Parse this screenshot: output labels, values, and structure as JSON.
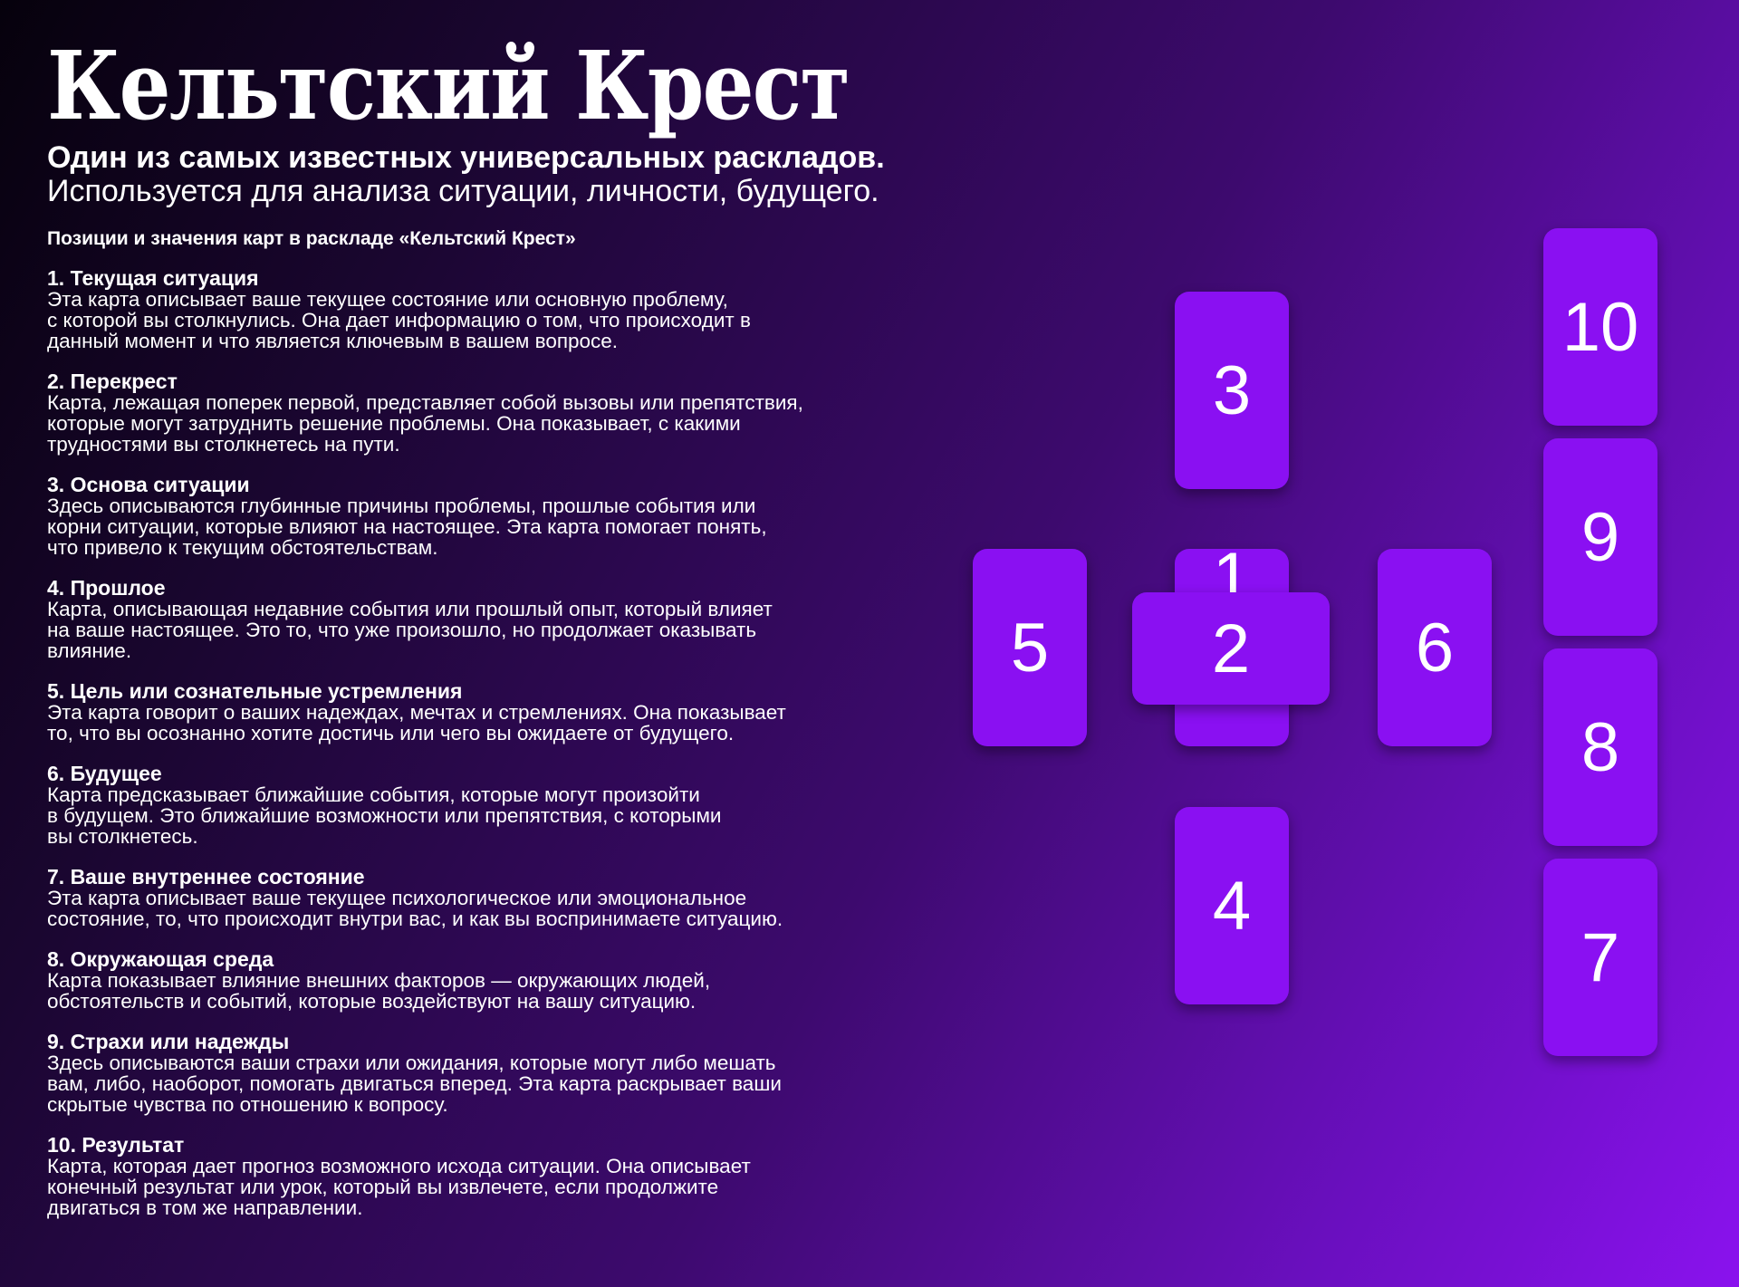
{
  "title": "Кельтский Крест",
  "subtitle_bold": "Один из самых известных универсальных раскладов.",
  "subtitle_regular": "Используется для анализа ситуации, личности, будущего.",
  "list_heading": "Позиции и значения карт в раскладе «Кельтский Крест»",
  "positions": [
    {
      "title": "1.  Текущая ситуация",
      "description": "Эта карта описывает ваше текущее состояние или основную проблему,\nс которой вы столкнулись. Она дает информацию о том, что происходит в\nданный момент и что является ключевым в вашем вопросе."
    },
    {
      "title": "2.  Перекрест",
      "description": "Карта, лежащая поперек первой, представляет собой вызовы или препятствия,\nкоторые могут затруднить решение проблемы. Она показывает, с какими\nтрудностями вы столкнетесь на пути."
    },
    {
      "title": "3.  Основа ситуации",
      "description": "Здесь описываются глубинные причины проблемы, прошлые события или\nкорни ситуации, которые влияют на настоящее. Эта карта помогает понять,\nчто привело к текущим обстоятельствам."
    },
    {
      "title": "4.  Прошлое",
      "description": "Карта, описывающая недавние события или прошлый опыт, который влияет\nна ваше настоящее. Это то, что уже произошло, но продолжает оказывать\nвлияние."
    },
    {
      "title": "5.  Цель или сознательные устремления",
      "description": "Эта карта говорит о ваших надеждах, мечтах и стремлениях. Она показывает\nто, что вы осознанно хотите достичь или чего вы ожидаете от будущего."
    },
    {
      "title": "6.  Будущее",
      "description": "Карта предсказывает ближайшие события, которые могут произойти\nв будущем. Это ближайшие возможности или препятствия, с которыми\nвы столкнетесь."
    },
    {
      "title": "7.  Ваше внутреннее состояние",
      "description": "Эта карта описывает ваше текущее психологическое или эмоциональное\nсостояние, то, что происходит внутри вас, и как вы воспринимаете ситуацию."
    },
    {
      "title": "8.  Окружающая среда",
      "description": "Карта показывает влияние внешних факторов — окружающих людей,\nобстоятельств и событий, которые воздействуют на вашу ситуацию."
    },
    {
      "title": "9.  Страхи или надежды",
      "description": "Здесь описываются ваши страхи или ожидания, которые могут либо мешать\nвам, либо, наоборот, помогать двигаться вперед. Эта карта раскрывает ваши\nскрытые чувства по отношению к вопросу."
    },
    {
      "title": "10.  Результат",
      "description": "Карта, которая дает прогноз возможного исхода ситуации. Она описывает\nконечный результат или урок, который вы извлечете, если продолжите\nдвигаться в том же направлении."
    }
  ],
  "cards": {
    "c1": "1",
    "c2": "2",
    "c3": "3",
    "c4": "4",
    "c5": "5",
    "c6": "6",
    "c7": "7",
    "c8": "8",
    "c9": "9",
    "c10": "10"
  },
  "colors": {
    "card": "#8a10f2",
    "text": "#ffffff",
    "background_start": "#06010c",
    "background_end": "#8a12ee"
  }
}
